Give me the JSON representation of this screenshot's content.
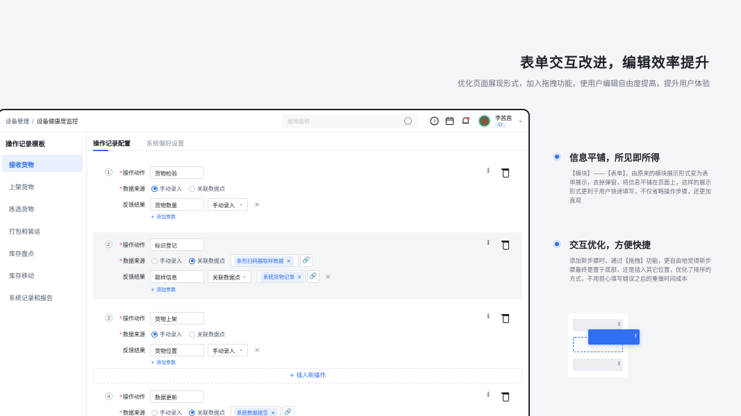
{
  "hero": {
    "title": "表单交互改进，编辑效率提升",
    "subtitle": "优化页面展现形式，加入拖拽功能，使用户编辑自由度提高，提升用户体验"
  },
  "app": {
    "breadcrumb": [
      "设备管理",
      "设备健康度监控"
    ],
    "search_placeholder": "故障报修",
    "user": {
      "name": "李茜茜",
      "tag": "ST"
    },
    "sidebar": {
      "title": "操作记录模板",
      "items": [
        "接收货物",
        "上架货物",
        "拣选货物",
        "打包和装运",
        "库存盘点",
        "库存移动",
        "系统记录和报告"
      ]
    },
    "tabs": [
      "操作记录配置",
      "系统偏好设置"
    ],
    "labels": {
      "action": "操作动作",
      "source": "数据来源",
      "feedback": "反馈结果",
      "manual": "手动录入",
      "linked": "关联数据点",
      "add_param": "+ 添加参数",
      "insert": "+ 插入新操作"
    },
    "steps": [
      {
        "num": "1",
        "action": "货物检验",
        "source": "手动录入",
        "feedback_value": "货物数量",
        "feedback_mode": "手动录入"
      },
      {
        "num": "2",
        "action": "标识登记",
        "source": "关联数据点",
        "source_tag": "条形扫码器取样数据",
        "feedback_value": "取样信息",
        "feedback_mode": "关联数据点",
        "feedback_tag": "系统货物记录"
      },
      {
        "num": "3",
        "action": "货物上架",
        "source": "手动录入",
        "feedback_value": "货物位置",
        "feedback_mode": "手动录入"
      },
      {
        "num": "4",
        "action": "数据更新",
        "source": "关联数据点",
        "source_tag": "系统数据报告"
      }
    ]
  },
  "features": [
    {
      "title": "信息平铺，所见即所得",
      "desc": "【模块】——【表单】，由原来的模块展示形式变为表单展示，去掉弹窗，将信息平铺在页面上，这样的展示形式更利于用户快速填写，不仅省略操作步骤，还更加直观"
    },
    {
      "title": "交互优化，方便快捷",
      "desc": "添加新步骤时，通过【拖拽】功能，更自由地觉得新步骤最终是置于底部，还是插入其它位置，优化了排序的方式，不用担心填写错误之后的重做时间成本"
    }
  ],
  "colors": {
    "accent": "#2f6ff0",
    "required": "#f53f3f"
  }
}
